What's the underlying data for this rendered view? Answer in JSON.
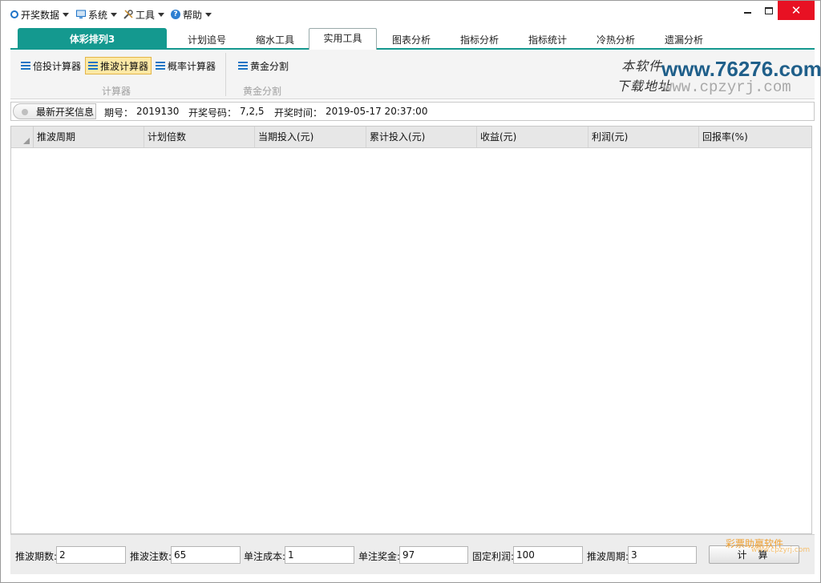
{
  "menu": {
    "items": [
      {
        "label": "开奖数据",
        "icon": "circle-icon"
      },
      {
        "label": "系统",
        "icon": "monitor-icon"
      },
      {
        "label": "工具",
        "icon": "tools-icon"
      },
      {
        "label": "帮助",
        "icon": "help-icon"
      }
    ]
  },
  "window": {
    "minimize": "—",
    "maximize": "□",
    "close": "✕"
  },
  "tabs": {
    "brand": "体彩排列3",
    "items": [
      "计划追号",
      "缩水工具",
      "实用工具",
      "图表分析",
      "指标分析",
      "指标统计",
      "冷热分析",
      "遗漏分析"
    ],
    "active": "实用工具"
  },
  "ribbon": {
    "calc_group": {
      "buttons": [
        "倍投计算器",
        "推波计算器",
        "概率计算器"
      ],
      "active": "推波计算器",
      "label": "计算器"
    },
    "gold_group": {
      "buttons": [
        "黄金分割"
      ],
      "label": "黄金分割"
    }
  },
  "watermark": {
    "line1_hand": "本软件",
    "line2_hand": "下载地址",
    "url_main": "www.76276.com",
    "url_sub": "www.cpzyrj.com"
  },
  "info": {
    "label": "最新开奖信息",
    "period_label": "期号：",
    "period_value": "2019130",
    "number_label": "开奖号码：",
    "number_value": "7,2,5",
    "time_label": "开奖时间：",
    "time_value": "2019-05-17 20:37:00"
  },
  "table": {
    "columns": [
      "推波周期",
      "计划倍数",
      "当期投入(元)",
      "累计投入(元)",
      "收益(元)",
      "利润(元)",
      "回报率(%)"
    ],
    "rows": []
  },
  "params": {
    "wave_periods": {
      "label": "推波期数:",
      "value": "2"
    },
    "wave_bets": {
      "label": "推波注数:",
      "value": "65"
    },
    "unit_cost": {
      "label": "单注成本:",
      "value": "1"
    },
    "unit_prize": {
      "label": "单注奖金:",
      "value": "97"
    },
    "fixed_profit": {
      "label": "固定利润:",
      "value": "100"
    },
    "wave_cycle": {
      "label": "推波周期:",
      "value": "3"
    },
    "calc_button": "计算",
    "calc_watermark": "彩票助赢软件",
    "calc_watermark_sub": "www.cpzyrj.com"
  },
  "colors": {
    "accent": "#14998f",
    "active_button_bg": "#fde9a5",
    "close_button": "#e81123",
    "watermark_url": "#1f5f8a"
  }
}
